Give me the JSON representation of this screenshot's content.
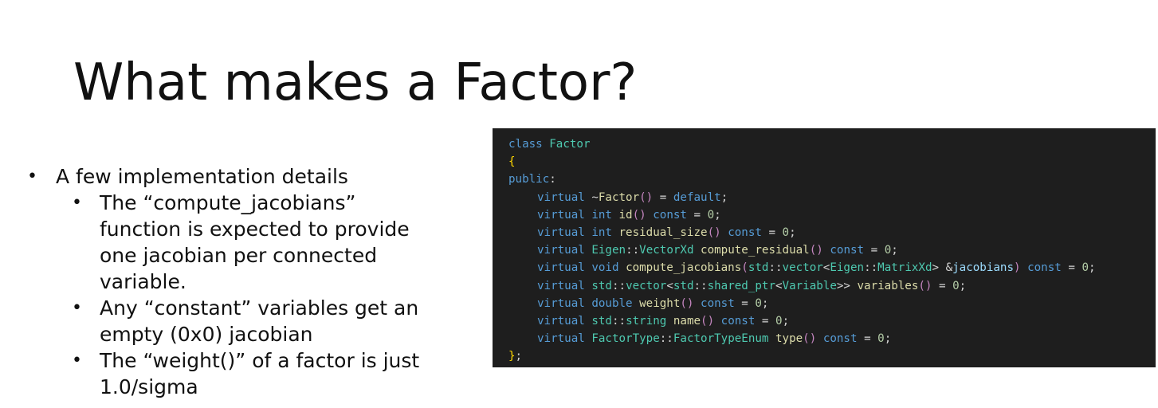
{
  "slide": {
    "title": "What makes a Factor?",
    "bullets": {
      "level1": [
        {
          "bullet": "•",
          "text": "A few implementation details"
        }
      ],
      "level2": [
        {
          "bullet": "•",
          "lines": [
            "The “compute_jacobians”",
            "function is expected to provide",
            "one jacobian per connected",
            "variable."
          ]
        },
        {
          "bullet": "•",
          "lines": [
            "Any “constant” variables get an",
            "empty (0x0) jacobian"
          ]
        },
        {
          "bullet": "•",
          "lines": [
            "The “weight()” of a factor is just",
            "1.0/sigma"
          ]
        }
      ]
    }
  },
  "code": {
    "lines": [
      {
        "indent": 0,
        "tokens": [
          [
            "kw",
            "class"
          ],
          [
            "pl",
            " "
          ],
          [
            "ty",
            "Factor"
          ]
        ]
      },
      {
        "indent": 0,
        "tokens": [
          [
            "br",
            "{"
          ]
        ]
      },
      {
        "indent": 0,
        "tokens": [
          [
            "kw",
            "public"
          ],
          [
            "pl",
            ":"
          ]
        ]
      },
      {
        "indent": 1,
        "tokens": [
          [
            "kw",
            "virtual"
          ],
          [
            "pl",
            " ~"
          ],
          [
            "fn",
            "Factor"
          ],
          [
            "pu",
            "()"
          ],
          [
            "pl",
            " = "
          ],
          [
            "kw",
            "default"
          ],
          [
            "pl",
            ";"
          ]
        ]
      },
      {
        "indent": 1,
        "tokens": [
          [
            "kw",
            "virtual"
          ],
          [
            "pl",
            " "
          ],
          [
            "kw",
            "int"
          ],
          [
            "pl",
            " "
          ],
          [
            "fn",
            "id"
          ],
          [
            "pu",
            "()"
          ],
          [
            "pl",
            " "
          ],
          [
            "kw",
            "const"
          ],
          [
            "pl",
            " = "
          ],
          [
            "num",
            "0"
          ],
          [
            "pl",
            ";"
          ]
        ]
      },
      {
        "indent": 1,
        "tokens": [
          [
            "kw",
            "virtual"
          ],
          [
            "pl",
            " "
          ],
          [
            "kw",
            "int"
          ],
          [
            "pl",
            " "
          ],
          [
            "fn",
            "residual_size"
          ],
          [
            "pu",
            "()"
          ],
          [
            "pl",
            " "
          ],
          [
            "kw",
            "const"
          ],
          [
            "pl",
            " = "
          ],
          [
            "num",
            "0"
          ],
          [
            "pl",
            ";"
          ]
        ]
      },
      {
        "indent": 1,
        "tokens": [
          [
            "kw",
            "virtual"
          ],
          [
            "pl",
            " "
          ],
          [
            "ty",
            "Eigen"
          ],
          [
            "pl",
            "::"
          ],
          [
            "ty",
            "VectorXd"
          ],
          [
            "pl",
            " "
          ],
          [
            "fn",
            "compute_residual"
          ],
          [
            "pu",
            "()"
          ],
          [
            "pl",
            " "
          ],
          [
            "kw",
            "const"
          ],
          [
            "pl",
            " = "
          ],
          [
            "num",
            "0"
          ],
          [
            "pl",
            ";"
          ]
        ]
      },
      {
        "indent": 1,
        "tokens": [
          [
            "kw",
            "virtual"
          ],
          [
            "pl",
            " "
          ],
          [
            "kw",
            "void"
          ],
          [
            "pl",
            " "
          ],
          [
            "fn",
            "compute_jacobians"
          ],
          [
            "pu",
            "("
          ],
          [
            "ty",
            "std"
          ],
          [
            "pl",
            "::"
          ],
          [
            "ty",
            "vector"
          ],
          [
            "pl",
            "<"
          ],
          [
            "ty",
            "Eigen"
          ],
          [
            "pl",
            "::"
          ],
          [
            "ty",
            "MatrixXd"
          ],
          [
            "pl",
            "> &"
          ],
          [
            "pm",
            "jacobians"
          ],
          [
            "pu",
            ")"
          ],
          [
            "pl",
            " "
          ],
          [
            "kw",
            "const"
          ],
          [
            "pl",
            " = "
          ],
          [
            "num",
            "0"
          ],
          [
            "pl",
            ";"
          ]
        ]
      },
      {
        "indent": 1,
        "tokens": [
          [
            "kw",
            "virtual"
          ],
          [
            "pl",
            " "
          ],
          [
            "ty",
            "std"
          ],
          [
            "pl",
            "::"
          ],
          [
            "ty",
            "vector"
          ],
          [
            "pl",
            "<"
          ],
          [
            "ty",
            "std"
          ],
          [
            "pl",
            "::"
          ],
          [
            "ty",
            "shared_ptr"
          ],
          [
            "pl",
            "<"
          ],
          [
            "ty",
            "Variable"
          ],
          [
            "pl",
            ">> "
          ],
          [
            "fn",
            "variables"
          ],
          [
            "pu",
            "()"
          ],
          [
            "pl",
            " = "
          ],
          [
            "num",
            "0"
          ],
          [
            "pl",
            ";"
          ]
        ]
      },
      {
        "indent": 1,
        "tokens": [
          [
            "kw",
            "virtual"
          ],
          [
            "pl",
            " "
          ],
          [
            "kw",
            "double"
          ],
          [
            "pl",
            " "
          ],
          [
            "fn",
            "weight"
          ],
          [
            "pu",
            "()"
          ],
          [
            "pl",
            " "
          ],
          [
            "kw",
            "const"
          ],
          [
            "pl",
            " = "
          ],
          [
            "num",
            "0"
          ],
          [
            "pl",
            ";"
          ]
        ]
      },
      {
        "indent": 1,
        "tokens": [
          [
            "kw",
            "virtual"
          ],
          [
            "pl",
            " "
          ],
          [
            "ty",
            "std"
          ],
          [
            "pl",
            "::"
          ],
          [
            "ty",
            "string"
          ],
          [
            "pl",
            " "
          ],
          [
            "fn",
            "name"
          ],
          [
            "pu",
            "()"
          ],
          [
            "pl",
            " "
          ],
          [
            "kw",
            "const"
          ],
          [
            "pl",
            " = "
          ],
          [
            "num",
            "0"
          ],
          [
            "pl",
            ";"
          ]
        ]
      },
      {
        "indent": 1,
        "tokens": [
          [
            "kw",
            "virtual"
          ],
          [
            "pl",
            " "
          ],
          [
            "ty",
            "FactorType"
          ],
          [
            "pl",
            "::"
          ],
          [
            "ty",
            "FactorTypeEnum"
          ],
          [
            "pl",
            " "
          ],
          [
            "fn",
            "type"
          ],
          [
            "pu",
            "()"
          ],
          [
            "pl",
            " "
          ],
          [
            "kw",
            "const"
          ],
          [
            "pl",
            " = "
          ],
          [
            "num",
            "0"
          ],
          [
            "pl",
            ";"
          ]
        ]
      },
      {
        "indent": 0,
        "tokens": [
          [
            "br",
            "}"
          ],
          [
            "pl",
            ";"
          ]
        ]
      }
    ]
  }
}
